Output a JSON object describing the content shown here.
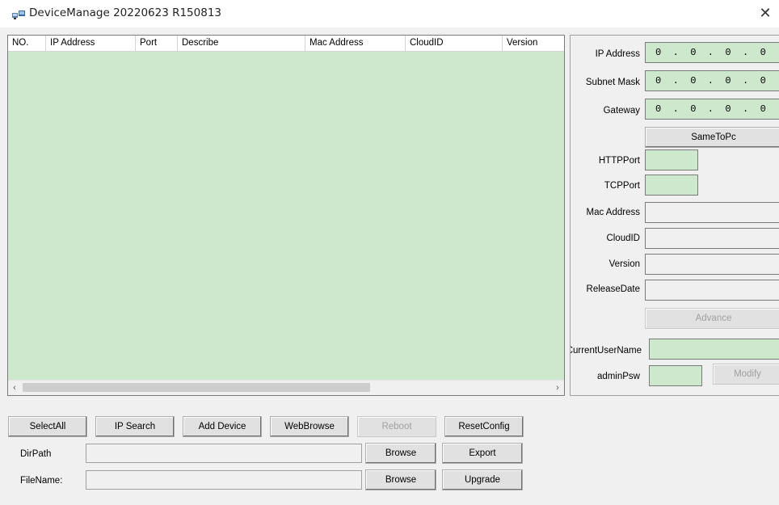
{
  "window": {
    "title": "DeviceManage 20220623 R150813",
    "app_icon": "network-devices-icon",
    "close_icon": "close-icon",
    "close_glyph": "✕"
  },
  "table": {
    "columns": [
      "NO.",
      "IP Address",
      "Port",
      "Describe",
      "Mac Address",
      "CloudID",
      "Version"
    ],
    "rows": [],
    "scroll_left": "‹",
    "scroll_right": "›"
  },
  "panel": {
    "ip_label": "IP Address",
    "ip_value": "0  .  0  .  0  .  0",
    "mask_label": "Subnet Mask",
    "mask_value": "0  .  0  .  0  .  0",
    "gateway_label": "Gateway",
    "gateway_value": "0  .  0  .  0  .  0",
    "same_to_pc": "SameToPc",
    "http_port_label": "HTTPPort",
    "tcp_port_label": "TCPPort",
    "mac_label": "Mac Address",
    "cloud_label": "CloudID",
    "version_label": "Version",
    "release_label": "ReleaseDate",
    "advance": "Advance",
    "user_label": "CurrentUserName",
    "psw_label": "adminPsw",
    "modify": "Modify"
  },
  "actions": {
    "select_all": "SelectAll",
    "ip_search": "IP Search",
    "add_device": "Add Device",
    "web_browse": "WebBrowse",
    "reboot": "Reboot",
    "reset_config": "ResetConfig"
  },
  "files": {
    "dirpath_label": "DirPath",
    "filename_label": "FileName:",
    "browse": "Browse",
    "export": "Export",
    "upgrade": "Upgrade"
  },
  "colors": {
    "accent_green": "#cde8cd",
    "window_bg": "#f0f0f0"
  }
}
